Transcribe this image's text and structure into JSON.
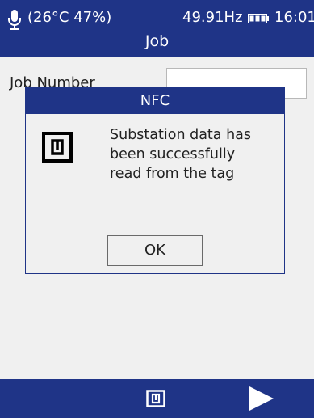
{
  "status_bar": {
    "environment": "(26°C 47%)",
    "frequency": "49.91Hz",
    "time": "16:01",
    "icons": [
      "microphone-icon",
      "battery-icon"
    ]
  },
  "header": {
    "title": "Job"
  },
  "form": {
    "job_number_label": "Job Number",
    "job_number_value": ""
  },
  "dialog": {
    "title": "NFC",
    "icon": "nfc-tag-icon",
    "message_lines": [
      "Substation data has",
      "been successfully",
      "read from the tag"
    ],
    "ok_label": "OK"
  },
  "footer": {
    "icons": [
      "nfc-icon",
      "play-icon"
    ]
  },
  "colors": {
    "primary": "#1f3487",
    "background": "#f0f0f0",
    "text": "#222222"
  }
}
